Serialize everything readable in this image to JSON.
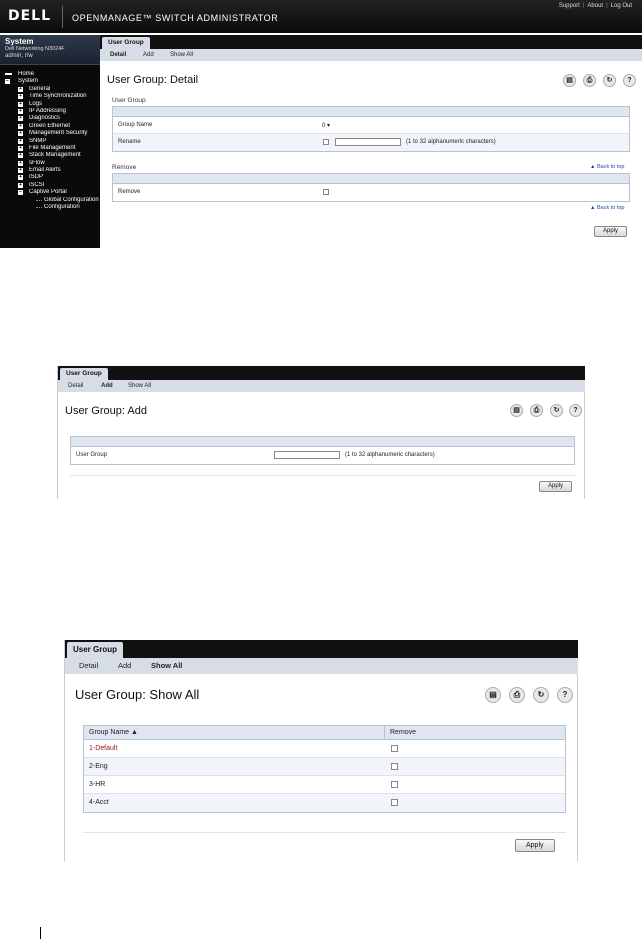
{
  "header": {
    "logo": "DELL",
    "product": "OPENMANAGE™ SWITCH ADMINISTRATOR",
    "links": [
      "Support",
      "About",
      "Log Out"
    ]
  },
  "sidebar": {
    "title": "System",
    "model": "Dell Networking N3024F",
    "user": "admin, r/w",
    "items": [
      {
        "label": "Home",
        "type": "home"
      },
      {
        "label": "System",
        "type": "sys",
        "icon": "minus"
      },
      {
        "label": "General",
        "type": "node",
        "icon": "plus"
      },
      {
        "label": "Time Synchronization",
        "type": "node",
        "icon": "plus"
      },
      {
        "label": "Logs",
        "type": "node",
        "icon": "plus"
      },
      {
        "label": "IP Addressing",
        "type": "node",
        "icon": "plus"
      },
      {
        "label": "Diagnostics",
        "type": "node",
        "icon": "plus"
      },
      {
        "label": "Green Ethernet",
        "type": "node",
        "icon": "plus"
      },
      {
        "label": "Management Security",
        "type": "node",
        "icon": "plus"
      },
      {
        "label": "SNMP",
        "type": "node",
        "icon": "plus"
      },
      {
        "label": "File Management",
        "type": "node",
        "icon": "plus"
      },
      {
        "label": "Stack Management",
        "type": "node",
        "icon": "plus"
      },
      {
        "label": "sFlow",
        "type": "node",
        "icon": "plus"
      },
      {
        "label": "Email Alerts",
        "type": "node",
        "icon": "plus"
      },
      {
        "label": "ISDP",
        "type": "node",
        "icon": "plus"
      },
      {
        "label": "iSCSI",
        "type": "node",
        "icon": "plus"
      },
      {
        "label": "Captive Portal",
        "type": "node",
        "icon": "minus"
      },
      {
        "label": "Global Configuration",
        "type": "sub"
      },
      {
        "label": "Configuration",
        "type": "sub"
      }
    ]
  },
  "tab": {
    "label": "User Group"
  },
  "subtabs": [
    "Detail",
    "Add",
    "Show All"
  ],
  "toolbar_icons": [
    "save-icon",
    "print-icon",
    "refresh-icon",
    "help-icon"
  ],
  "detail": {
    "title": "User Group: Detail",
    "section1": "User Group",
    "group_name_label": "Group Name",
    "group_name_value": "0",
    "rename_label": "Rename",
    "rename_hint": "(1 to 32 alphanumeric characters)",
    "section2": "Remove",
    "remove_label": "Remove",
    "back_to_top": "▲ Back to top",
    "apply": "Apply"
  },
  "add": {
    "title": "User Group: Add",
    "user_group_label": "User Group",
    "hint": "(1 to 32 alphanumeric characters)",
    "apply": "Apply"
  },
  "showall": {
    "title": "User Group: Show All",
    "col_group": "Group Name ▲",
    "col_remove": "Remove",
    "rows": [
      "1-Default",
      "2-Eng",
      "3-HR",
      "4-Acct"
    ],
    "apply": "Apply"
  }
}
